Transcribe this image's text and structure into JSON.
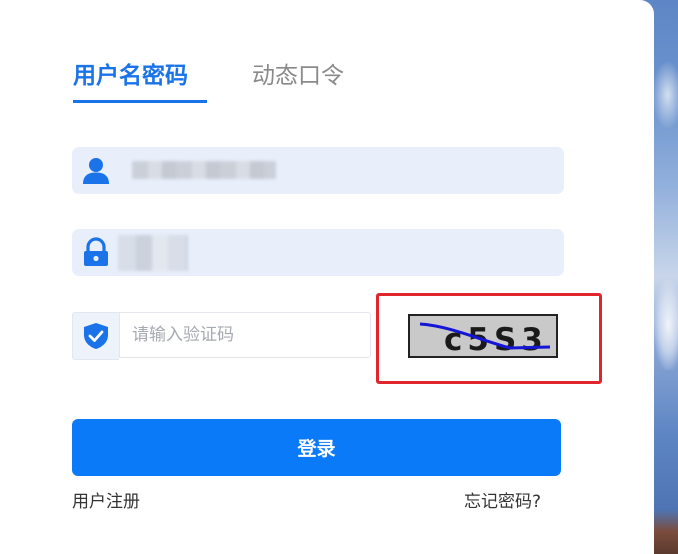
{
  "tabs": [
    {
      "label": "用户名密码",
      "active": true
    },
    {
      "label": "动态口令",
      "active": false
    }
  ],
  "username_field": {
    "icon": "user-icon",
    "value_state": "obscured"
  },
  "password_field": {
    "icon": "lock-icon",
    "value_state": "obscured"
  },
  "captcha": {
    "icon": "shield-check-icon",
    "placeholder": "请输入验证码",
    "value": "",
    "image_text": "c5S3"
  },
  "login_button": {
    "label": "登录"
  },
  "links": {
    "register": "用户注册",
    "forgot_password": "忘记密码?"
  },
  "colors": {
    "accent": "#1a73e8",
    "button": "#0a7af8",
    "field_background": "#e8effb",
    "highlight": "#e0262c"
  }
}
